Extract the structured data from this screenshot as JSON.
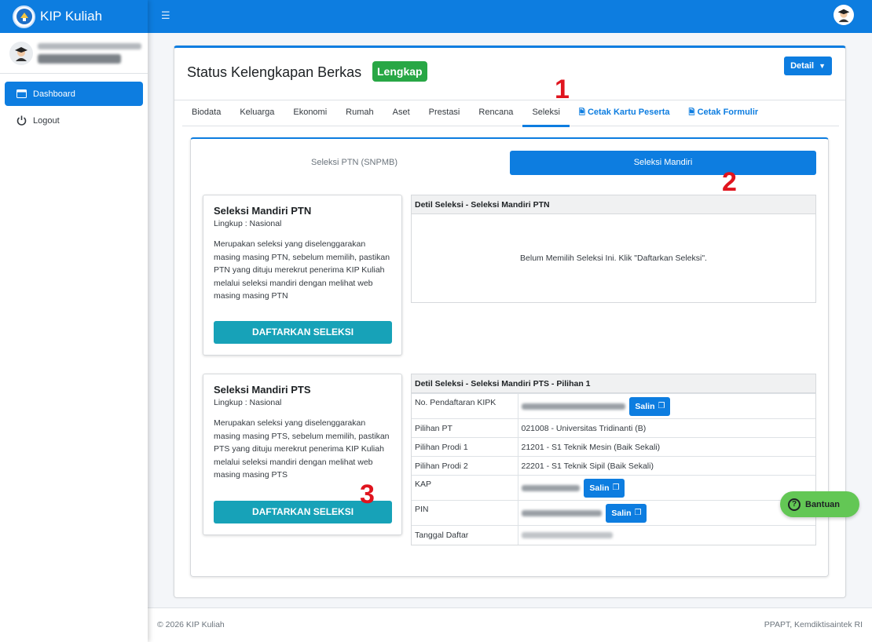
{
  "brand": {
    "title": "KIP Kuliah"
  },
  "sidebar": {
    "items": [
      {
        "label": "Dashboard"
      },
      {
        "label": "Logout"
      }
    ]
  },
  "topbar": {
    "menu_icon": "hamburger-icon"
  },
  "card": {
    "title": "Status Kelengkapan Berkas",
    "badge": "Lengkap",
    "detail_button": "Detail"
  },
  "tabs": [
    {
      "label": "Biodata"
    },
    {
      "label": "Keluarga"
    },
    {
      "label": "Ekonomi"
    },
    {
      "label": "Rumah"
    },
    {
      "label": "Aset"
    },
    {
      "label": "Prestasi"
    },
    {
      "label": "Rencana"
    },
    {
      "label": "Seleksi"
    },
    {
      "label": "Cetak Kartu Peserta"
    },
    {
      "label": "Cetak Formulir"
    }
  ],
  "markers": {
    "m1": "1",
    "m2": "2",
    "m3": "3"
  },
  "subtabs": {
    "ptn": "Seleksi PTN (SNPMB)",
    "mandiri": "Seleksi Mandiri"
  },
  "ptn_card": {
    "title": "Seleksi Mandiri PTN",
    "scope": "Lingkup : Nasional",
    "desc": "Merupakan seleksi yang diselenggarakan masing masing PTN, sebelum memilih, pastikan PTN yang dituju merekrut penerima KIP Kuliah melalui seleksi mandiri dengan melihat web masing masing PTN",
    "button": "DAFTARKAN SELEKSI"
  },
  "pts_card": {
    "title": "Seleksi Mandiri PTS",
    "scope": "Lingkup : Nasional",
    "desc": "Merupakan seleksi yang diselenggarakan masing masing PTS, sebelum memilih, pastikan PTS yang dituju merekrut penerima KIP Kuliah melalui seleksi mandiri dengan melihat web masing masing PTS",
    "button": "DAFTARKAN SELEKSI"
  },
  "ptn_detail": {
    "header": "Detil Seleksi - Seleksi Mandiri PTN",
    "empty": "Belum Memilih Seleksi Ini. Klik \"Daftarkan Seleksi\"."
  },
  "pts_detail": {
    "header": "Detil Seleksi - Seleksi Mandiri PTS - Pilihan 1",
    "copy_label": "Salin",
    "rows": [
      {
        "key": "No. Pendaftaran KIPK",
        "value": ""
      },
      {
        "key": "Pilihan PT",
        "value": "021008 - Universitas Tridinanti (B)"
      },
      {
        "key": "Pilihan Prodi 1",
        "value": "21201 - S1 Teknik Mesin (Baik Sekali)"
      },
      {
        "key": "Pilihan Prodi 2",
        "value": "22201 - S1 Teknik Sipil (Baik Sekali)"
      },
      {
        "key": "KAP",
        "value": ""
      },
      {
        "key": "PIN",
        "value": ""
      },
      {
        "key": "Tanggal Daftar",
        "value": ""
      }
    ]
  },
  "help_button": "Bantuan",
  "footer": {
    "left": "© 2026 KIP Kuliah",
    "right": "PPAPT, Kemdiktisaintek RI"
  }
}
